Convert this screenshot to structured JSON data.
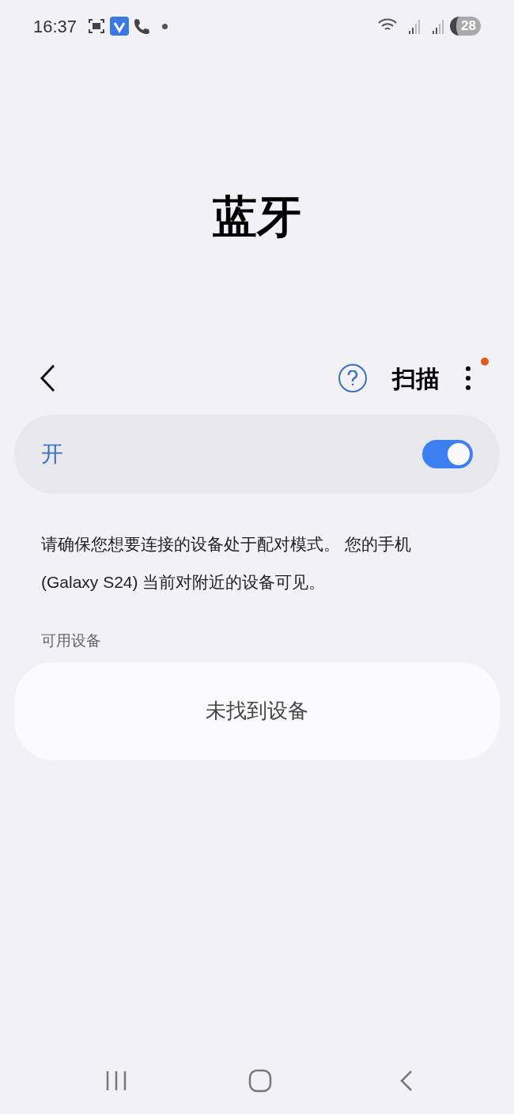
{
  "status_bar": {
    "time": "16:37",
    "battery": "28"
  },
  "title": "蓝牙",
  "toolbar": {
    "action": "扫描",
    "menu_badge": true
  },
  "master_switch": {
    "label": "开",
    "on": true
  },
  "description": "请确保您想要连接的设备处于配对模式。 您的手机 (Galaxy S24) 当前对附近的设备可见。",
  "section_header": "可用设备",
  "empty_message": "未找到设备"
}
